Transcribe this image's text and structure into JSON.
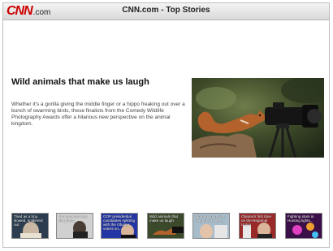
{
  "header": {
    "logo_text": "CNN",
    "logo_suffix": ".com",
    "title": "CNN.com - Top Stories"
  },
  "story": {
    "headline": "Wild animals that make us laugh",
    "summary": "Whether it's a gorilla giving the middle finger or a hippo freaking out over a bunch of swarming birds, these finalists from the Comedy Wildlife Photography Awards offer a hilarious new perspective on the animal kingdom."
  },
  "thumbnails": [
    {
      "caption": "Tried as a boy, slowed, soldiered out"
    },
    {
      "caption": "The tent that was the photo"
    },
    {
      "caption": "GOP presidential candidates splitting with the Obama voters on..."
    },
    {
      "caption": "Wild animals that make us laugh"
    },
    {
      "caption": "Woman fights with neighbor Twitter..."
    },
    {
      "caption": "Obama's first time on the Regional Union"
    },
    {
      "caption": "Fighting stars in Hunting lights..."
    }
  ],
  "colors": {
    "brand_red": "#cc0000",
    "header_bg": "#e2e2e2"
  }
}
